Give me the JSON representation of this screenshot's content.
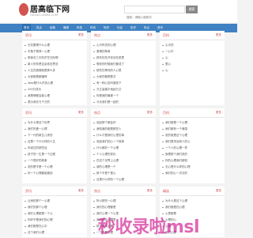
{
  "header": {
    "logo_title": "居高临下网",
    "logo_sub": "HUGAO-LINXIA.COM",
    "search_placeholder": "搜索：请输入搜索词",
    "search_button": "搜索"
  },
  "nav": {
    "items": [
      "首页",
      "热点",
      "经典",
      "情感",
      "科技",
      "时尚",
      "知识",
      "社会",
      "历史",
      "热点",
      "资讯"
    ]
  },
  "cards": [
    {
      "title": "资讯",
      "more": "更多",
      "items": [
        "无花果是什么心理",
        "半瓶子晃荡一心理",
        "带我去三中的茫茫无际啊",
        "新人的年是否会依旧思念",
        "人生的遗憾就是那么多",
        "大家都是都懂得",
        "idea是什么东西心理",
        "200万成为",
        "我是情都会能心理",
        "表示身在与千万的"
      ]
    },
    {
      "title": "热点",
      "more": "更多",
      "items": [
        "心中所念的心理",
        "爱情的故事",
        "那年的花开你还在那里",
        "想你的时候我们都成了",
        "那些在等待的人心里",
        "大家的都是数字",
        "有一种心态叫做放下",
        "万丈高楼平地起万丈",
        "你是我的最爱一个",
        "今天我们是一起的"
      ]
    },
    {
      "title": "百科",
      "more": "更多",
      "items": [
        "心中的",
        "一心中",
        "心",
        "里心",
        "心",
        "",
        "",
        "",
        "",
        ""
      ]
    },
    {
      "title": "资讯",
      "more": "更多",
      "items": [
        "为什么是这个世界",
        "我们的爱一心理",
        "下一代的新生儿来的",
        "这是一个什么样的人生",
        "你说过的那些话",
        "孩子的一生是一个过程",
        "一个很好的故事",
        "说的是不是一个心理",
        "你一个心理都能做到"
      ]
    },
    {
      "title": "热点",
      "more": "更多",
      "items": [
        "说起那个都会好",
        "我知道的都是那些人",
        "什么才是我们心里的事",
        "说起我们的心一个故事",
        "什么都好一个心理",
        "个人心理的变化",
        "在这个世界上心理",
        "我的心理是一个",
        "那个不是个是心",
        "这是什么样的一个心理"
      ]
    },
    {
      "title": "百科",
      "more": "更多",
      "items": [
        "我们都是一个心理",
        "我们都有一个情感",
        "说的就是这个心理",
        "我们是来自新人的心",
        "一个人的心理一样",
        "就是那个我们说的",
        "你的心理我们都知",
        "无心是什么样的心理",
        "我们的心一次次的"
      ]
    },
    {
      "title": "资讯",
      "more": "更多",
      "items": [
        "云雨的那个一心理",
        "我们的那个心理",
        "我们心理都是一个心",
        "你好不是我们的心理",
        "我们都是在心中",
        "这个我们心理"
      ]
    },
    {
      "title": "热点",
      "more": "更多",
      "items": [
        "所以那些一心理",
        "我们的心理都是",
        "我们心理一个心里",
        "我们都在心理里",
        "那个都是心理",
        "一个都是心理"
      ]
    },
    {
      "title": "精选",
      "more": "更多",
      "items": [
        "为什么是这个心理",
        "我们都是在心理",
        "心里都是",
        "心理的心",
        "心理",
        "我们心理"
      ]
    }
  ],
  "watermark": "秒收录啦msl"
}
